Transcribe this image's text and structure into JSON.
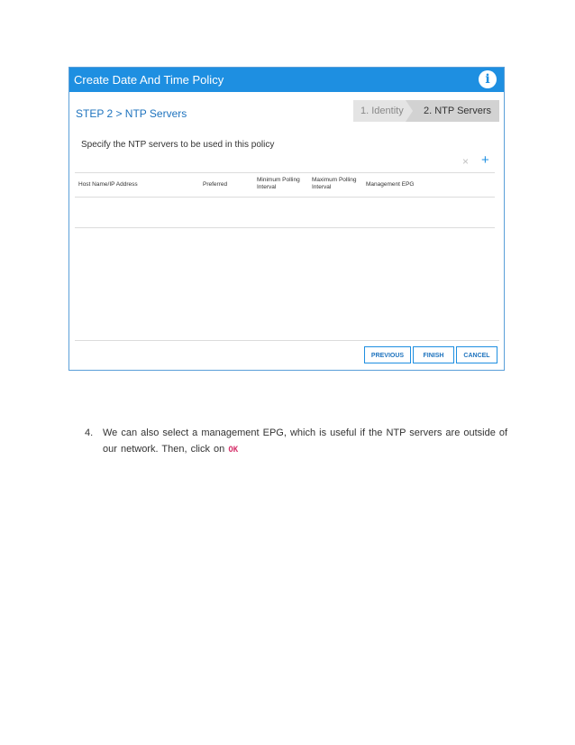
{
  "dialog": {
    "title": "Create Date And Time Policy",
    "info_icon": "i",
    "step_title": "STEP 2 > NTP Servers",
    "wizard_steps": [
      {
        "label": "1. Identity",
        "active": false
      },
      {
        "label": "2. NTP Servers",
        "active": true
      }
    ],
    "instruction": "Specify the NTP servers to be used in this policy",
    "toolbar": {
      "delete_icon": "×",
      "add_icon": "+"
    },
    "table": {
      "columns": [
        "Host Name/IP Address",
        "Preferred",
        "Minimum Polling Interval",
        "Maximum Polling Interval",
        "Management EPG"
      ],
      "rows": []
    },
    "buttons": {
      "previous": "PREVIOUS",
      "finish": "FINISH",
      "cancel": "CANCEL"
    }
  },
  "document": {
    "step_number": "4.",
    "step_text": "We can also select a management EPG, which is useful if the NTP servers are outside of our network. Then, click on",
    "code": "OK"
  },
  "colors": {
    "header_blue": "#1e8fe1",
    "title_blue": "#1e73be",
    "code_pink": "#d6336c"
  }
}
